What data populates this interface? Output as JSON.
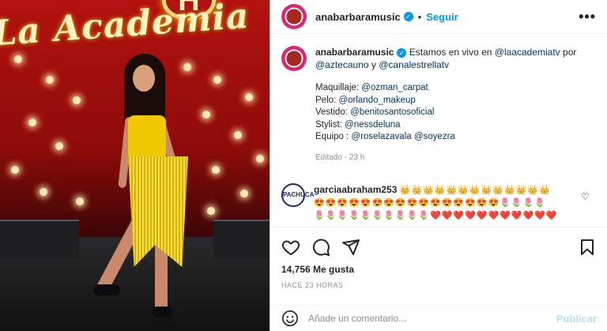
{
  "photo": {
    "logo_text": "La Academia",
    "logo_letter": "H"
  },
  "header": {
    "username": "anabarbaramusic",
    "verified_mark": "✓",
    "separator": "•",
    "follow_label": "Seguir",
    "more_label": "•••"
  },
  "caption": {
    "username": "anabarbaramusic",
    "verified_mark": "✓",
    "text_1": "Estamos en vivo en ",
    "mention_1": "@laacademiatv",
    "text_2": " por ",
    "mention_2": "@aztecauno",
    "text_3": " y ",
    "mention_3": "@canalestrellatv",
    "credits": [
      {
        "label": "Maquillaje: ",
        "handle": "@ozman_carpat"
      },
      {
        "label": "Pelo: ",
        "handle": "@orlando_makeup"
      },
      {
        "label": "Vestido: ",
        "handle": "@benitosantosoficial"
      },
      {
        "label": "Stylist: ",
        "handle": "@nessdeluna"
      },
      {
        "label": "Equipo : ",
        "handle": "@roselazavala"
      }
    ],
    "extra_handle": "@soyezra",
    "edited": "Editado · 23 h"
  },
  "comment": {
    "avatar_text": "PACHUCA",
    "username": "garciaabraham253",
    "emojis_1": "👑👑👑👑👑👑👑👑👑👑👑👑👑",
    "emojis_2": "😍😍😍😍😍😍😍😍😍😍😍😍😍😍😍😍🌷🌷🌷🌷",
    "emojis_3": "🌷🌷🌷🌷🌷🌷🌷🌷🌷🌷❤️❤️❤️❤️❤️❤️❤️❤️❤️❤️❤️",
    "like_icon": "♡"
  },
  "actions": {
    "likes": "14,756 Me gusta",
    "time_ago": "HACE 23 HORAS"
  },
  "add_comment": {
    "placeholder": "Añade un comentario...",
    "publish_label": "Publicar"
  },
  "colors": {
    "accent": "#0095f6",
    "publish_disabled": "#b2dffc",
    "mention": "#00376b",
    "muted": "#8e8e8e"
  }
}
